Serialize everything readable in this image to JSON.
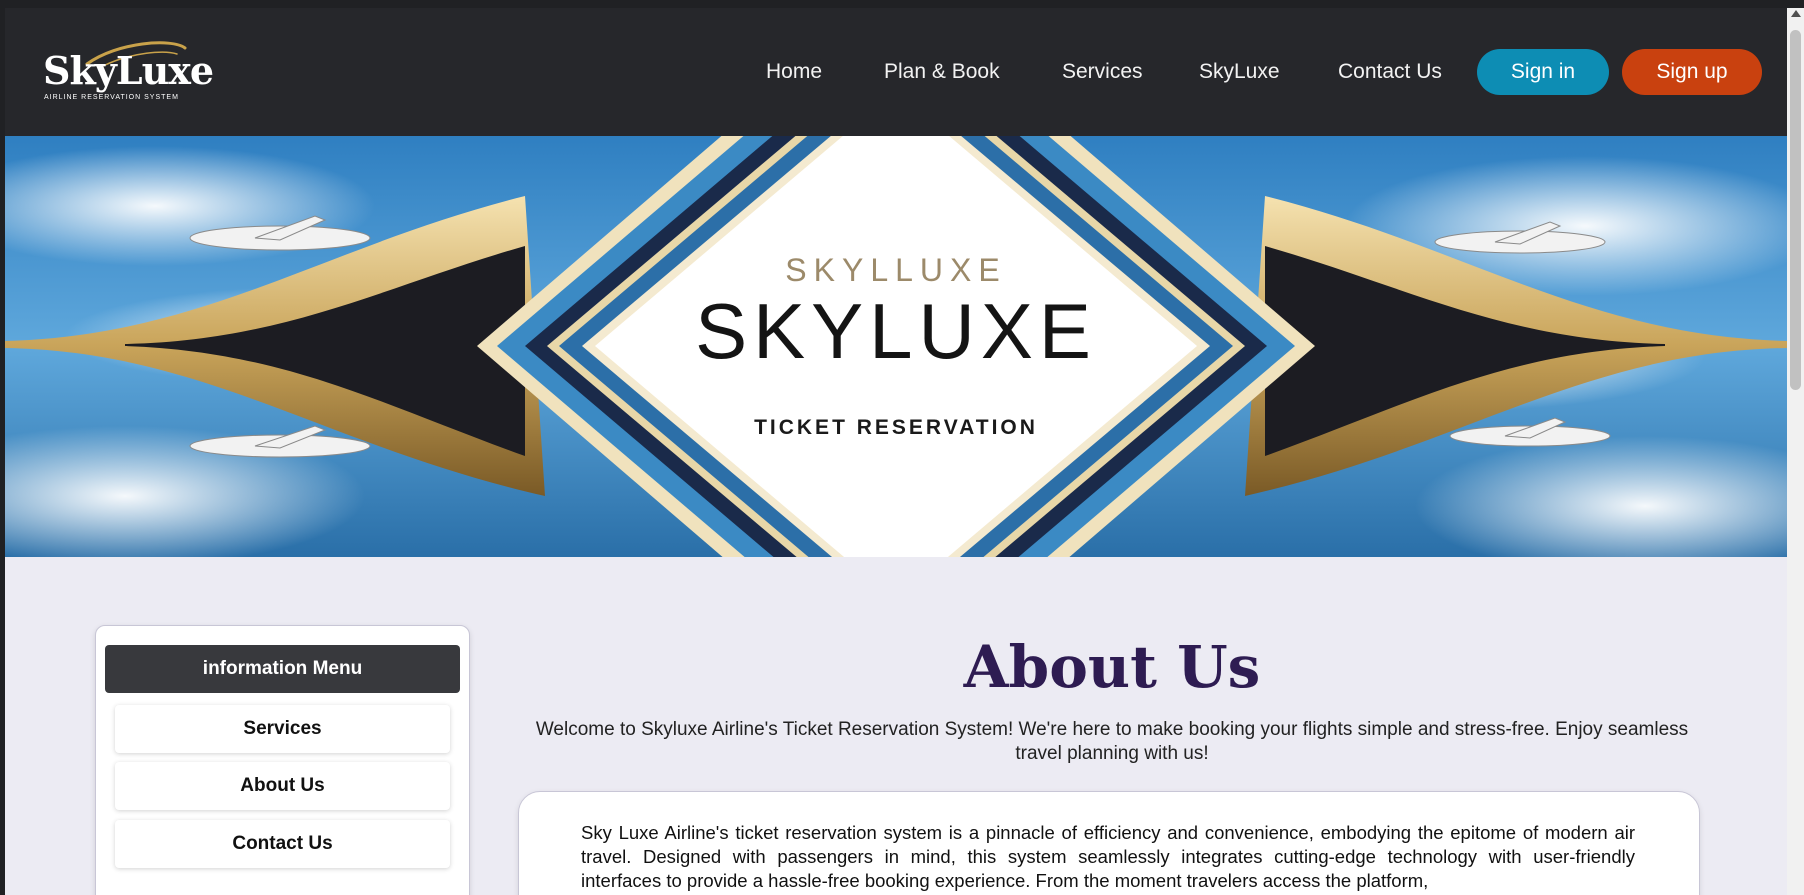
{
  "logo": {
    "name": "SkyLuxe",
    "tagline": "AIRLINE    RESERVATION  SYSTEM"
  },
  "nav": {
    "links": [
      "Home",
      "Plan & Book",
      "Services",
      "SkyLuxe",
      "Contact Us"
    ],
    "signin_label": "Sign in",
    "signup_label": "Sign up"
  },
  "hero": {
    "top_text": "SKYLLUXE",
    "main_text": "SKYLUXE",
    "sub_text": "TICKET RESERVATION"
  },
  "sidebar": {
    "title": "information Menu",
    "items": [
      "Services",
      "About Us",
      "Contact Us"
    ]
  },
  "about": {
    "title": "About Us",
    "intro": "Welcome to Skyluxe Airline's Ticket Reservation System! We're here to make booking your flights simple and stress-free. Enjoy seamless travel planning with us!",
    "body": "Sky Luxe Airline's ticket reservation system is a pinnacle of efficiency and convenience, embodying the epitome of modern air travel. Designed with passengers in mind, this system seamlessly integrates cutting-edge technology with user-friendly interfaces to provide a hassle-free booking experience. From the moment travelers access the platform,"
  },
  "colors": {
    "header_bg": "#26272b",
    "signin": "#0d8db4",
    "signup": "#c9410f",
    "title": "#2e1c52",
    "page_bg": "#ecebf3"
  }
}
